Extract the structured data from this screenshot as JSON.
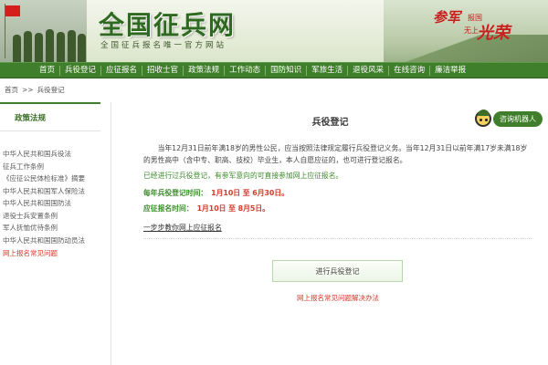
{
  "header": {
    "site_title": "全国征兵网",
    "site_subtitle": "全国征兵报名唯一官方网站",
    "slogan_left": "参军",
    "slogan_top": "报国",
    "slogan_bottom": "无上",
    "slogan_right": "光荣"
  },
  "nav": {
    "items": [
      "首页",
      "兵役登记",
      "应征报名",
      "招收士官",
      "政策法规",
      "工作动态",
      "国防知识",
      "军旅生活",
      "退役风采",
      "在线咨询",
      "廉洁举报"
    ]
  },
  "breadcrumb": {
    "home": "首页",
    "separator": ">>",
    "current": "兵役登记"
  },
  "sidebar": {
    "title": "政策法规",
    "links": [
      "中华人民共和国兵役法",
      "征兵工作条例",
      "《应征公民体检标准》摘要",
      "中华人民共和国军人保险法",
      "中华人民共和国国防法",
      "退役士兵安置条例",
      "军人抚恤优待条例",
      "中华人民共和国国防动员法"
    ],
    "faq": "网上报名常见问题"
  },
  "main": {
    "title": "兵役登记",
    "robot_label": "咨询机器人",
    "para1": "当年12月31日前年满18岁的男性公民，应当按照法律规定履行兵役登记义务。当年12月31日以前年满17岁未满18岁的男性高中（含中专、职高、技校）毕业生，本人自愿应征的，也可进行登记报名。",
    "para2": "已经进行过兵役登记，有参军意向的可直接参加网上应征报名。",
    "reg_time_label": "每年兵役登记时间：",
    "reg_time_value": "1月10日 至 6月30日。",
    "apply_time_label": "应征报名时间：",
    "apply_time_value": "1月10日 至 8月5日。",
    "guide_link": "一步步教你网上应征报名",
    "register_button": "进行兵役登记",
    "faq_link": "网上报名常见问题解决办法"
  },
  "colors": {
    "brand_green": "#3f7e2a",
    "alert_red": "#d23a2a"
  }
}
